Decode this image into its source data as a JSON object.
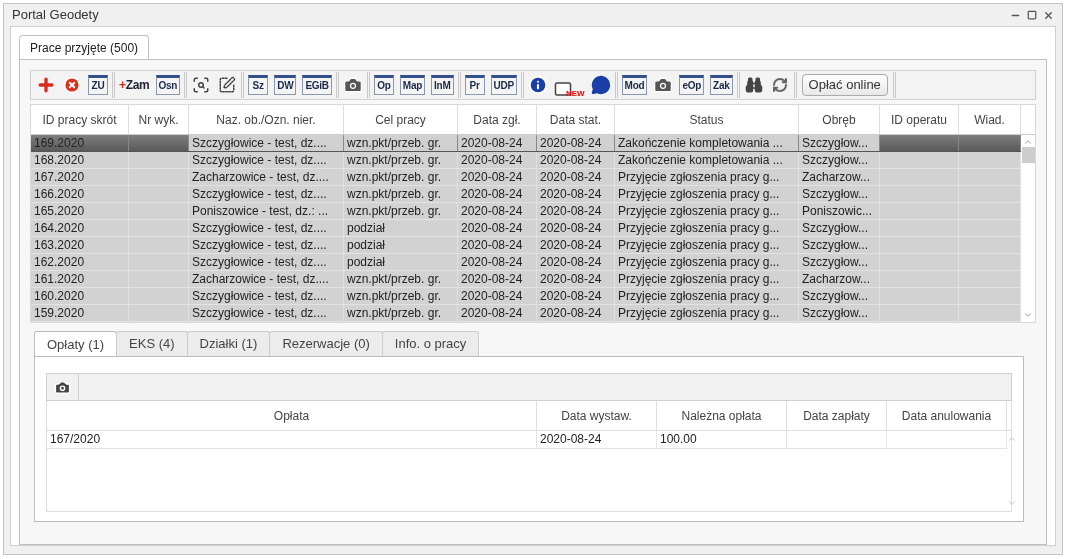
{
  "window": {
    "title": "Portal Geodety"
  },
  "tabs": [
    {
      "label": "Prace przyjęte (500)",
      "selected": true
    }
  ],
  "toolbar": [
    {
      "kind": "add"
    },
    {
      "kind": "cancel"
    },
    {
      "kind": "label",
      "label": "ZU"
    },
    {
      "kind": "separator"
    },
    {
      "kind": "plus-label",
      "prefix": "+",
      "label": "Zam"
    },
    {
      "kind": "label",
      "label": "Osn"
    },
    {
      "kind": "separator"
    },
    {
      "kind": "select-search"
    },
    {
      "kind": "select-edit"
    },
    {
      "kind": "separator"
    },
    {
      "kind": "label",
      "label": "Sz"
    },
    {
      "kind": "label",
      "label": "DW"
    },
    {
      "kind": "label",
      "label": "EGiB"
    },
    {
      "kind": "separator"
    },
    {
      "kind": "select-camera"
    },
    {
      "kind": "separator"
    },
    {
      "kind": "label",
      "label": "Op"
    },
    {
      "kind": "label",
      "label": "Map"
    },
    {
      "kind": "label",
      "label": "InM"
    },
    {
      "kind": "separator"
    },
    {
      "kind": "label",
      "label": "Pr"
    },
    {
      "kind": "label",
      "label": "UDP"
    },
    {
      "kind": "separator"
    },
    {
      "kind": "info"
    },
    {
      "kind": "mail",
      "badge": "NEW"
    },
    {
      "kind": "chat"
    },
    {
      "kind": "separator"
    },
    {
      "kind": "label",
      "label": "Mod"
    },
    {
      "kind": "camera"
    },
    {
      "kind": "label",
      "label": "eOp"
    },
    {
      "kind": "label",
      "label": "Zak"
    },
    {
      "kind": "separator"
    },
    {
      "kind": "binoculars"
    },
    {
      "kind": "refresh"
    },
    {
      "kind": "separator"
    },
    {
      "kind": "text",
      "label": "Opłać online"
    },
    {
      "kind": "separator"
    }
  ],
  "table": {
    "columns": [
      "ID pracy skrót",
      "Nr wyk.",
      "Naz. ob./Ozn. nier.",
      "Cel pracy",
      "Data zgł.",
      "Data stat.",
      "Status",
      "Obręb",
      "ID operatu",
      "Wiad."
    ],
    "rows": [
      {
        "selected": true,
        "cells": [
          "169.2020",
          "",
          "Szczygłowice - test, dz....",
          "wzn.pkt/przeb. gr.",
          "2020-08-24",
          "2020-08-24",
          "Zakończenie kompletowania ...",
          "Szczygłow...",
          "",
          ""
        ]
      },
      {
        "selected": false,
        "cells": [
          "168.2020",
          "",
          "Szczygłowice - test, dz....",
          "wzn.pkt/przeb. gr.",
          "2020-08-24",
          "2020-08-24",
          "Zakończenie kompletowania ...",
          "Szczygłow...",
          "",
          ""
        ]
      },
      {
        "selected": false,
        "cells": [
          "167.2020",
          "",
          "Zacharzowice - test, dz....",
          "wzn.pkt/przeb. gr.",
          "2020-08-24",
          "2020-08-24",
          "Przyjęcie zgłoszenia pracy g...",
          "Zacharzow...",
          "",
          ""
        ]
      },
      {
        "selected": false,
        "cells": [
          "166.2020",
          "",
          "Szczygłowice - test, dz....",
          "wzn.pkt/przeb. gr.",
          "2020-08-24",
          "2020-08-24",
          "Przyjęcie zgłoszenia pracy g...",
          "Szczygłow...",
          "",
          ""
        ]
      },
      {
        "selected": false,
        "cells": [
          "165.2020",
          "",
          "Poniszowice - test, dz.: ...",
          "wzn.pkt/przeb. gr.",
          "2020-08-24",
          "2020-08-24",
          "Przyjęcie zgłoszenia pracy g...",
          "Poniszowic...",
          "",
          ""
        ]
      },
      {
        "selected": false,
        "cells": [
          "164.2020",
          "",
          "Szczygłowice - test, dz....",
          "podział",
          "2020-08-24",
          "2020-08-24",
          "Przyjęcie zgłoszenia pracy g...",
          "Szczygłow...",
          "",
          ""
        ]
      },
      {
        "selected": false,
        "cells": [
          "163.2020",
          "",
          "Szczygłowice - test, dz....",
          "podział",
          "2020-08-24",
          "2020-08-24",
          "Przyjęcie zgłoszenia pracy g...",
          "Szczygłow...",
          "",
          ""
        ]
      },
      {
        "selected": false,
        "cells": [
          "162.2020",
          "",
          "Szczygłowice - test, dz....",
          "podział",
          "2020-08-24",
          "2020-08-24",
          "Przyjęcie zgłoszenia pracy g...",
          "Szczygłow...",
          "",
          ""
        ]
      },
      {
        "selected": false,
        "cells": [
          "161.2020",
          "",
          "Zacharzowice - test, dz....",
          "wzn.pkt/przeb. gr.",
          "2020-08-24",
          "2020-08-24",
          "Przyjęcie zgłoszenia pracy g...",
          "Zacharzow...",
          "",
          ""
        ]
      },
      {
        "selected": false,
        "cells": [
          "160.2020",
          "",
          "Szczygłowice - test, dz....",
          "wzn.pkt/przeb. gr.",
          "2020-08-24",
          "2020-08-24",
          "Przyjęcie zgłoszenia pracy g...",
          "Szczygłow...",
          "",
          ""
        ]
      },
      {
        "selected": false,
        "cells": [
          "159.2020",
          "",
          "Szczygłowice - test, dz....",
          "wzn.pkt/przeb. gr.",
          "2020-08-24",
          "2020-08-24",
          "Przyjęcie zgłoszenia pracy g...",
          "Szczygłow...",
          "",
          ""
        ]
      }
    ]
  },
  "detail_tabs": [
    {
      "label": "Opłaty (1)",
      "selected": true
    },
    {
      "label": "EKS (4)",
      "selected": false
    },
    {
      "label": "Działki (1)",
      "selected": false
    },
    {
      "label": "Rezerwacje (0)",
      "selected": false
    },
    {
      "label": "Info. o pracy",
      "selected": false
    }
  ],
  "fees_table": {
    "columns": [
      "Opłata",
      "Data wystaw.",
      "Należna opłata",
      "Data zapłaty",
      "Data anulowania"
    ],
    "rows": [
      {
        "cells": [
          "167/2020",
          "2020-08-24",
          "100.00",
          "",
          ""
        ]
      }
    ]
  }
}
